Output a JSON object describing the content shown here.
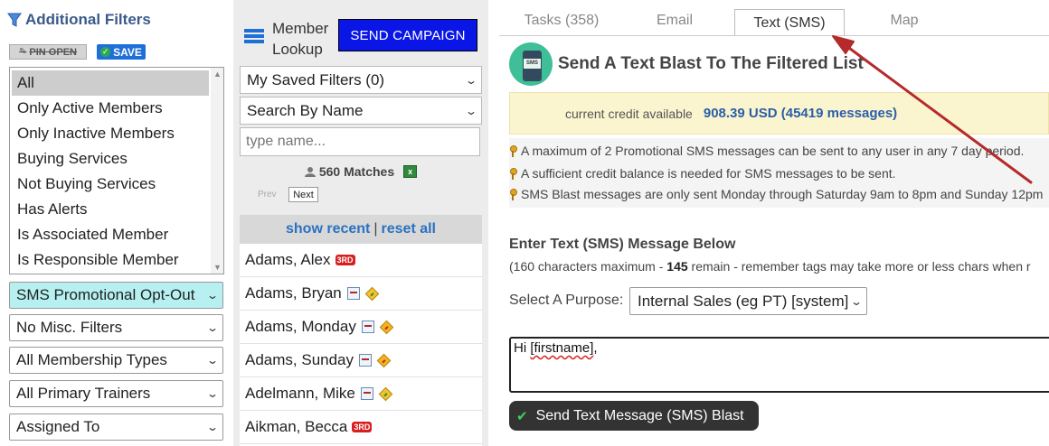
{
  "filters": {
    "title": "Additional Filters",
    "pin_label": "PIN OPEN",
    "save_label": "SAVE",
    "status_options": [
      "All",
      "Only Active Members",
      "Only Inactive Members",
      "Buying Services",
      "Not Buying Services",
      "Has Alerts",
      "Is Associated Member",
      "Is Responsible Member"
    ],
    "selected_status": "All",
    "selects": [
      {
        "value": "SMS Promotional Opt-Out"
      },
      {
        "value": "No Misc. Filters"
      },
      {
        "value": "All Membership Types"
      },
      {
        "value": "All Primary Trainers"
      },
      {
        "value": "Assigned To"
      }
    ]
  },
  "lookup": {
    "title_line1": "Member",
    "title_line2": "Lookup",
    "send_campaign_label": "SEND CAMPAIGN",
    "saved_filters": "My Saved Filters (0)",
    "search_by": "Search By Name",
    "name_placeholder": "type name...",
    "matches": "560 Matches",
    "prev_label": "Prev",
    "next_label": "Next",
    "show_recent": "show recent",
    "separator": "|",
    "reset_all": "reset all",
    "members": [
      {
        "name": "Adams, Alex",
        "badge": "3RD"
      },
      {
        "name": "Adams, Bryan",
        "icons": [
          "calendar-icon",
          "alert-green-icon"
        ]
      },
      {
        "name": "Adams, Monday",
        "icons": [
          "calendar-icon",
          "alert-red-icon"
        ]
      },
      {
        "name": "Adams, Sunday",
        "icons": [
          "calendar-icon",
          "alert-red-icon"
        ]
      },
      {
        "name": "Adelmann, Mike",
        "icons": [
          "calendar-icon",
          "alert-green-icon"
        ]
      },
      {
        "name": "Aikman, Becca",
        "badge": "3RD"
      }
    ]
  },
  "tabs": [
    {
      "label": "Tasks (358)",
      "active": false
    },
    {
      "label": "Email",
      "active": false
    },
    {
      "label": "Text (SMS)",
      "active": true
    },
    {
      "label": "Map",
      "active": false
    }
  ],
  "sms": {
    "title": "Send A Text Blast To The Filtered List",
    "icon_text": "SMS",
    "credit_label": "current credit available",
    "credit_amount": "908.39 USD (45419 messages)",
    "notes": [
      "A maximum of 2 Promotional SMS messages can be sent to any user in any 7 day period.",
      "A sufficient credit balance is needed for SMS messages to be sent.",
      "SMS Blast messages are only sent Monday through Saturday 9am to 8pm and Sunday 12pm"
    ],
    "enter_title": "Enter Text (SMS) Message Below",
    "remain_prefix": "(160 characters maximum - ",
    "remain_count": "145",
    "remain_suffix": " remain - remember tags may take more or less chars when r",
    "purpose_label": "Select A Purpose:",
    "purpose_value": "Internal Sales (eg PT) [system]",
    "message_prefix": "Hi ",
    "message_tag": "[firstname]",
    "message_suffix": ",",
    "send_label": "Send Text Message (SMS) Blast"
  },
  "colors": {
    "accent": "#1e6fd8",
    "send_campaign": "#0a16e6",
    "arrow": "#b52a2a",
    "credit_bg": "#fbf5cf",
    "optout_bg": "#b6f0f0"
  }
}
